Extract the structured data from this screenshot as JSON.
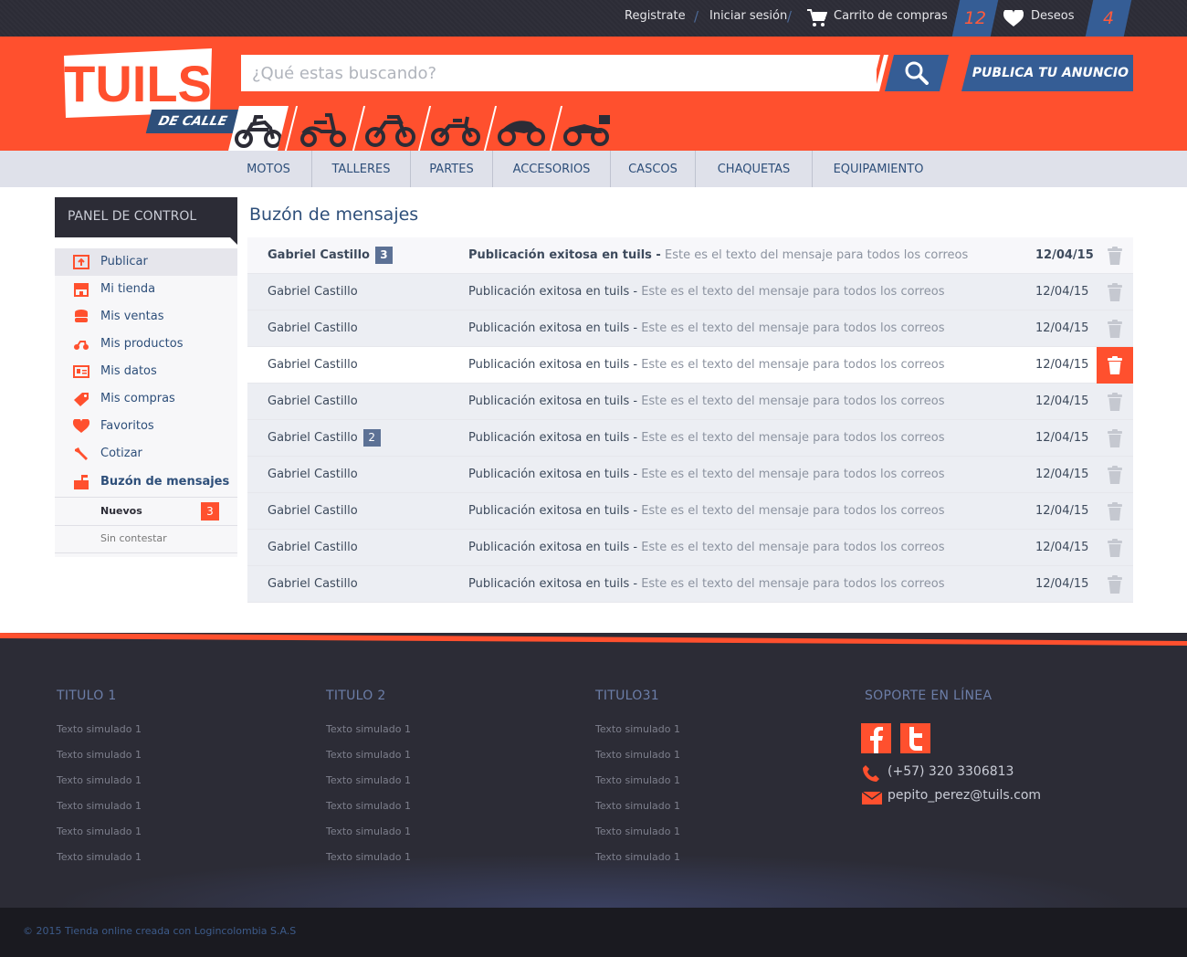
{
  "topbar": {
    "register": "Registrate",
    "login": "Iniciar sesión",
    "cart_label": "Carrito de compras",
    "cart_count": "12",
    "wishlist_label": "Deseos",
    "wishlist_count": "4"
  },
  "header": {
    "logo_text": "TUILS",
    "logo_sub": "DE CALLE",
    "search_placeholder": "¿Qué estas buscando?",
    "publish_label": "PUBLICA TU ANUNCIO",
    "categories": [
      "moto-calle-icon",
      "scooter-icon",
      "moto-cross-icon",
      "moto-chopper-icon",
      "moto-deportiva-icon",
      "moto-touring-icon"
    ]
  },
  "nav": [
    "MOTOS",
    "TALLERES",
    "PARTES",
    "ACCESORIOS",
    "CASCOS",
    "CHAQUETAS",
    "EQUIPAMIENTO"
  ],
  "sidebar": {
    "title": "PANEL DE CONTROL",
    "items": [
      "Publicar",
      "Mi tienda",
      "Mis ventas",
      "Mis productos",
      "Mis datos",
      "Mis compras",
      "Favoritos",
      "Cotizar",
      "Buzón de mensajes"
    ],
    "sub_items": [
      {
        "label": "Nuevos",
        "count": "3"
      },
      {
        "label": "Sin contestar"
      }
    ]
  },
  "main": {
    "title": "Buzón de mensajes",
    "messages": [
      {
        "sender": "Gabriel Castillo",
        "badge": "3",
        "subject": "Publicación exitosa en tuils -",
        "body": "Este es el texto del mensaje para todos los correos",
        "date": "12/04/15"
      },
      {
        "sender": "Gabriel Castillo",
        "badge": "",
        "subject": "Publicación exitosa en tuils -",
        "body": "Este es el texto del mensaje para todos los correos",
        "date": "12/04/15"
      },
      {
        "sender": "Gabriel Castillo",
        "badge": "",
        "subject": "Publicación exitosa en tuils -",
        "body": "Este es el texto del mensaje para todos los correos",
        "date": "12/04/15"
      },
      {
        "sender": "Gabriel Castillo",
        "badge": "",
        "subject": "Publicación exitosa en tuils -",
        "body": "Este es el texto del mensaje para todos los correos",
        "date": "12/04/15"
      },
      {
        "sender": "Gabriel Castillo",
        "badge": "",
        "subject": "Publicación exitosa en tuils -",
        "body": "Este es el texto del mensaje para todos los correos",
        "date": "12/04/15"
      },
      {
        "sender": "Gabriel Castillo",
        "badge": "2",
        "subject": "Publicación exitosa en tuils -",
        "body": "Este es el texto del mensaje para todos los correos",
        "date": "12/04/15"
      },
      {
        "sender": "Gabriel Castillo",
        "badge": "",
        "subject": "Publicación exitosa en tuils -",
        "body": "Este es el texto del mensaje para todos los correos",
        "date": "12/04/15"
      },
      {
        "sender": "Gabriel Castillo",
        "badge": "",
        "subject": "Publicación exitosa en tuils -",
        "body": "Este es el texto del mensaje para todos los correos",
        "date": "12/04/15"
      },
      {
        "sender": "Gabriel Castillo",
        "badge": "",
        "subject": "Publicación exitosa en tuils -",
        "body": "Este es el texto del mensaje para todos los correos",
        "date": "12/04/15"
      },
      {
        "sender": "Gabriel Castillo",
        "badge": "",
        "subject": "Publicación exitosa en tuils -",
        "body": "Este es el texto del mensaje para todos los correos",
        "date": "12/04/15"
      }
    ]
  },
  "footer": {
    "columns": [
      {
        "title": "TITULO 1",
        "links": [
          "Texto simulado 1",
          "Texto simulado 1",
          "Texto simulado 1",
          "Texto simulado 1",
          "Texto simulado 1",
          "Texto simulado 1"
        ]
      },
      {
        "title": "TITULO 2",
        "links": [
          "Texto simulado 1",
          "Texto simulado 1",
          "Texto simulado 1",
          "Texto simulado 1",
          "Texto simulado 1",
          "Texto simulado 1"
        ]
      },
      {
        "title": "TITULO31",
        "links": [
          "Texto simulado 1",
          "Texto simulado 1",
          "Texto simulado 1",
          "Texto simulado 1",
          "Texto simulado 1",
          "Texto simulado 1"
        ]
      }
    ],
    "support": {
      "title": "SOPORTE EN LÍNEA",
      "phone": "(+57) 320 3306813",
      "email": "pepito_perez@tuils.com"
    },
    "copyright": "© 2015 Tienda online creada con Logincolombia S.A.S"
  },
  "colors": {
    "accent": "#ff502e",
    "brand_blue": "#355d95",
    "dark": "#2c2c36"
  }
}
